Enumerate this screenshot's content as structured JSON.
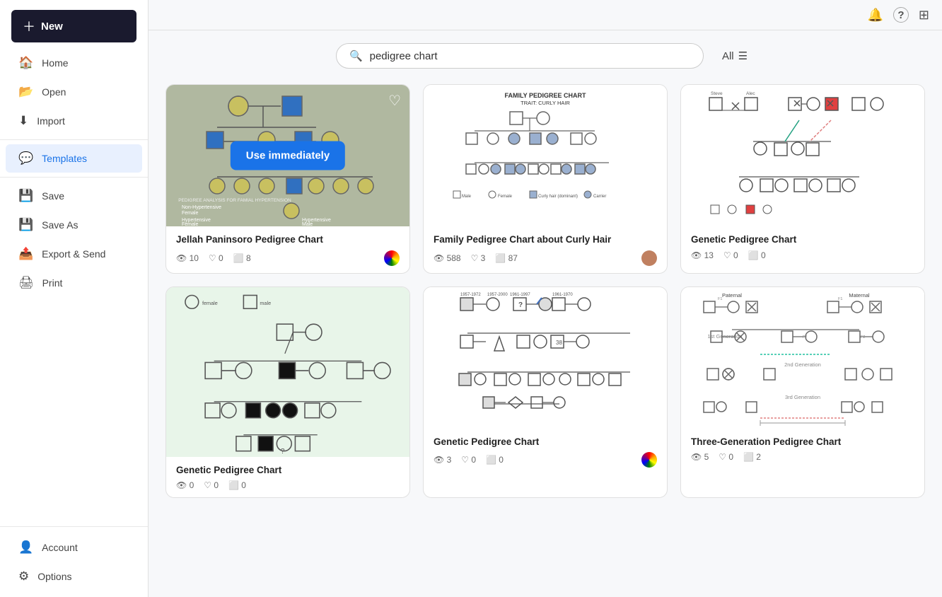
{
  "sidebar": {
    "new_label": "New",
    "items": [
      {
        "id": "home",
        "label": "Home",
        "icon": "🏠"
      },
      {
        "id": "open",
        "label": "Open",
        "icon": "📂"
      },
      {
        "id": "import",
        "label": "Import",
        "icon": "⬇"
      },
      {
        "id": "templates",
        "label": "Templates",
        "icon": "💬",
        "active": true
      },
      {
        "id": "save",
        "label": "Save",
        "icon": "💾"
      },
      {
        "id": "save-as",
        "label": "Save As",
        "icon": "💾"
      },
      {
        "id": "export",
        "label": "Export & Send",
        "icon": "🖨"
      },
      {
        "id": "print",
        "label": "Print",
        "icon": "🖨"
      }
    ],
    "bottom_items": [
      {
        "id": "account",
        "label": "Account",
        "icon": "👤"
      },
      {
        "id": "options",
        "label": "Options",
        "icon": "⚙"
      }
    ]
  },
  "topbar": {
    "notification_icon": "🔔",
    "help_icon": "?",
    "grid_icon": "⊞"
  },
  "search": {
    "placeholder": "pedigree chart",
    "value": "pedigree chart",
    "filter_label": "All"
  },
  "templates": {
    "cards": [
      {
        "id": "card-1",
        "title": "Jellah Paninsoro Pedigree Chart",
        "views": 10,
        "likes": 0,
        "copies": 8,
        "has_use_btn": true,
        "has_heart": true,
        "bg_class": "active-card",
        "avatar_class": "colorful"
      },
      {
        "id": "card-2",
        "title": "Family Pedigree Chart about Curly Hair",
        "views": 588,
        "likes": 3,
        "copies": 87,
        "has_use_btn": false,
        "has_heart": false,
        "bg_class": "white-bg",
        "avatar_class": "avatar-photo"
      },
      {
        "id": "card-3",
        "title": "Genetic Pedigree Chart",
        "views": 13,
        "likes": 0,
        "copies": 0,
        "has_use_btn": false,
        "has_heart": false,
        "bg_class": "white-bg",
        "avatar_class": ""
      },
      {
        "id": "card-4",
        "title": "Genetic Pedigree Chart",
        "views": 0,
        "likes": 0,
        "copies": 0,
        "has_use_btn": false,
        "has_heart": false,
        "bg_class": "light-green",
        "avatar_class": ""
      },
      {
        "id": "card-5",
        "title": "Genetic Pedigree Chart",
        "views": 3,
        "likes": 0,
        "copies": 0,
        "has_use_btn": false,
        "has_heart": false,
        "bg_class": "white-bg",
        "avatar_class": "colorful"
      },
      {
        "id": "card-6",
        "title": "Three-Generation Pedigree Chart",
        "views": 5,
        "likes": 0,
        "copies": 2,
        "has_use_btn": false,
        "has_heart": false,
        "bg_class": "white-bg",
        "avatar_class": ""
      }
    ],
    "use_immediately_label": "Use immediately"
  }
}
